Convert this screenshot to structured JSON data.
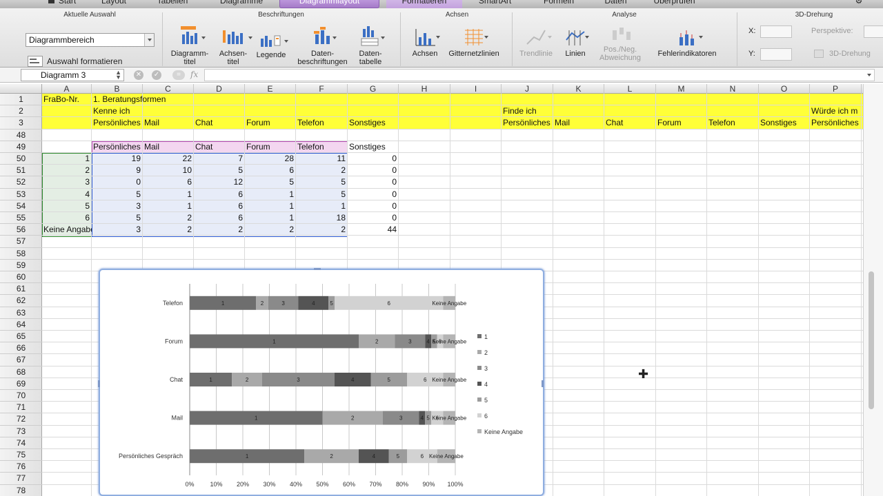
{
  "tabs": [
    "Start",
    "Layout",
    "Tabellen",
    "Diagramme",
    "Diagrammlayout",
    "Formatieren",
    "SmartArt",
    "Formeln",
    "Daten",
    "Überprüfen"
  ],
  "ribbon": {
    "groups": {
      "current_selection": "Aktuelle Auswahl",
      "labels": "Beschriftungen",
      "axes": "Achsen",
      "analysis": "Analyse",
      "rotation": "3D-Drehung"
    },
    "selection_value": "Diagrammbereich",
    "format_selection": "Auswahl formatieren",
    "buttons": {
      "chart_title": "Diagramm-\ntitel",
      "axis_titles": "Achsen-\ntitel",
      "legend": "Legende",
      "data_labels": "Daten-\nbeschriftungen",
      "data_table": "Daten-\ntabelle",
      "axes": "Achsen",
      "gridlines": "Gitternetzlinien",
      "trendline": "Trendlinie",
      "lines": "Linien",
      "updown": "Pos./Neg.\nAbweichung",
      "errorbars": "Fehlerindikatoren",
      "x_label": "X:",
      "y_label": "Y:",
      "perspective": "Perspektive:",
      "rotation_3d": "3D-Drehung"
    }
  },
  "formula_bar": {
    "name_box": "Diagramm 3",
    "fx": "fx"
  },
  "columns": [
    "A",
    "B",
    "C",
    "D",
    "E",
    "F",
    "G",
    "H",
    "I",
    "J",
    "K",
    "L",
    "M",
    "N",
    "O",
    "P"
  ],
  "rows": [
    "1",
    "2",
    "3",
    "48",
    "49",
    "50",
    "51",
    "52",
    "53",
    "54",
    "55",
    "56",
    "57",
    "58",
    "59",
    "60",
    "61",
    "62",
    "63",
    "64",
    "65",
    "66",
    "67",
    "68",
    "69",
    "70",
    "71",
    "72",
    "73",
    "74",
    "75",
    "76",
    "77",
    "78"
  ],
  "cells": {
    "a1": "FraBo-Nr.",
    "b1": "1. Beratungsformen",
    "b2": "Kenne ich",
    "j2": "Finde ich",
    "p2": "Würde ich m",
    "row3": [
      "Persönliches",
      "Mail",
      "Chat",
      "Forum",
      "Telefon",
      "Sonstiges"
    ],
    "row3_j": [
      "Persönliches",
      "Mail",
      "Chat",
      "Forum",
      "Telefon",
      "Sonstiges",
      "Persönliches"
    ],
    "row49": [
      "Persönliches",
      "Mail",
      "Chat",
      "Forum",
      "Telefon",
      "Sonstiges"
    ],
    "data_rows": [
      [
        "1",
        "19",
        "22",
        "7",
        "28",
        "11",
        "0"
      ],
      [
        "2",
        "9",
        "10",
        "5",
        "6",
        "2",
        "0"
      ],
      [
        "3",
        "0",
        "6",
        "12",
        "5",
        "5",
        "0"
      ],
      [
        "4",
        "5",
        "1",
        "6",
        "1",
        "5",
        "0"
      ],
      [
        "5",
        "3",
        "1",
        "6",
        "1",
        "1",
        "0"
      ],
      [
        "6",
        "5",
        "2",
        "6",
        "1",
        "18",
        "0"
      ],
      [
        "Keine Angabe",
        "3",
        "2",
        "2",
        "2",
        "2",
        "44"
      ]
    ]
  },
  "chart_data": {
    "type": "bar",
    "orientation": "horizontal",
    "stacking": "percent",
    "categories": [
      "Persönliches Gespräch",
      "Mail",
      "Chat",
      "Forum",
      "Telefon"
    ],
    "series": [
      {
        "name": "1",
        "values": [
          19,
          22,
          7,
          28,
          11
        ],
        "color": "#6e6e6e"
      },
      {
        "name": "2",
        "values": [
          9,
          10,
          5,
          6,
          2
        ],
        "color": "#a9a9a9"
      },
      {
        "name": "3",
        "values": [
          0,
          6,
          12,
          5,
          5
        ],
        "color": "#8a8a8a"
      },
      {
        "name": "4",
        "values": [
          5,
          1,
          6,
          1,
          5
        ],
        "color": "#545454"
      },
      {
        "name": "5",
        "values": [
          3,
          1,
          6,
          1,
          1
        ],
        "color": "#9c9c9c"
      },
      {
        "name": "6",
        "values": [
          5,
          2,
          6,
          1,
          18
        ],
        "color": "#d2d2d2"
      },
      {
        "name": "Keine Angabe",
        "values": [
          3,
          2,
          2,
          2,
          2
        ],
        "color": "#b4b4b4"
      }
    ],
    "x_ticks": [
      "0%",
      "10%",
      "20%",
      "30%",
      "40%",
      "50%",
      "60%",
      "70%",
      "80%",
      "90%",
      "100%"
    ],
    "xlim": [
      0,
      100
    ],
    "grid": "vertical",
    "legend_position": "right"
  }
}
